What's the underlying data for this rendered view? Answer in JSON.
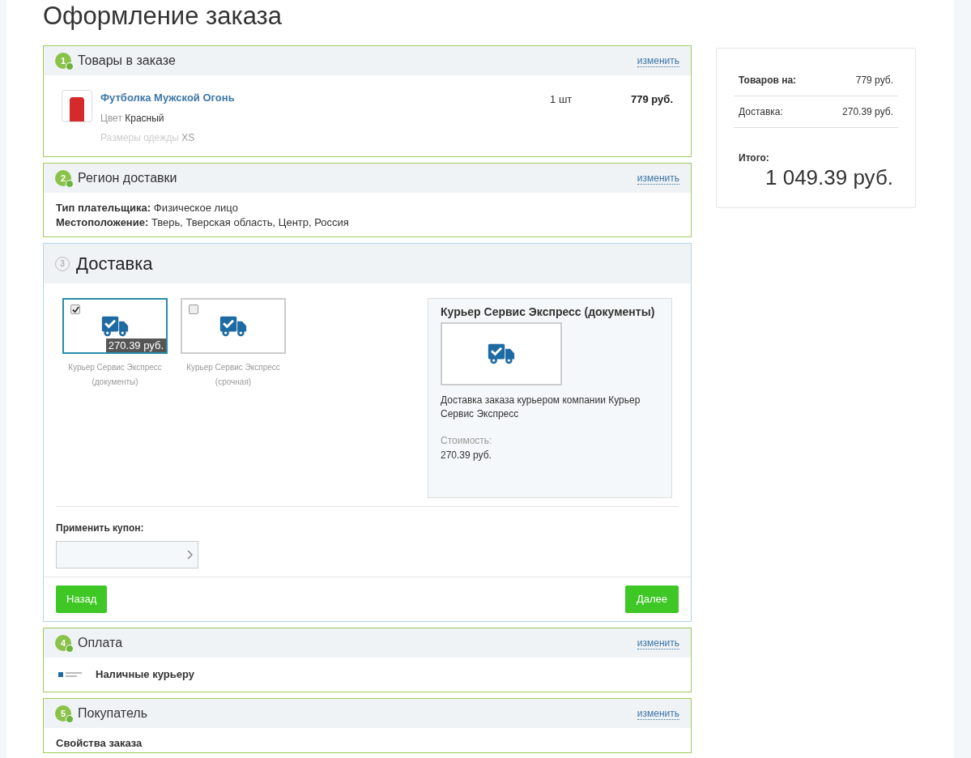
{
  "page_title": "Оформление заказа",
  "sections": [
    {
      "number": "1",
      "title": "Товары в заказе",
      "active": false,
      "change_link": "изменить",
      "kind": "items"
    },
    {
      "number": "2",
      "title": "Регион доставки",
      "active": false,
      "change_link": "изменить",
      "kind": "region"
    },
    {
      "number": "3",
      "title": "Доставка",
      "active": true,
      "kind": "delivery"
    },
    {
      "number": "4",
      "title": "Оплата",
      "active": false,
      "change_link": "изменить",
      "kind": "payment"
    },
    {
      "number": "5",
      "title": "Покупатель",
      "active": false,
      "change_link": "изменить",
      "kind": "buyer"
    }
  ],
  "order_item": {
    "name": "Футболка Мужской Огонь",
    "props": [
      {
        "label": "Цвет",
        "value": "Красный",
        "faded": false
      },
      {
        "label": "Размеры одежды",
        "value": "XS",
        "faded": true
      }
    ],
    "quantity": "1 шт",
    "price": "779 руб."
  },
  "region": [
    {
      "label": "Тип плательщика:",
      "value": "Физическое лицо"
    },
    {
      "label": "Местоположение:",
      "value": "Тверь, Тверская область, Центр, Россия"
    }
  ],
  "delivery_options": [
    {
      "name": "Курьер Сервис Экспресс (документы)",
      "selected": true,
      "price": "270.39 руб."
    },
    {
      "name": "Курьер Сервис Экспресс (срочная)",
      "selected": false
    }
  ],
  "delivery_details": {
    "title": "Курьер Сервис Экспресс (документы)",
    "description": "Доставка заказа курьером компании Курьер Сервис Экспресс",
    "cost_label": "Стоимость:",
    "cost": "270.39 руб."
  },
  "coupon": {
    "label": "Применить купон:"
  },
  "buttons": {
    "back": "Назад",
    "next": "Далее"
  },
  "payment": {
    "name": "Наличные курьеру"
  },
  "buyer": {
    "subtitle": "Свойства заказа"
  },
  "summary": {
    "rows": [
      {
        "label": "Товаров на:",
        "value": "779 руб.",
        "bold": true
      },
      {
        "label": "Доставка:",
        "value": "270.39 руб.",
        "bold": false
      }
    ],
    "total_label": "Итого:",
    "total": "1 049.39 руб."
  }
}
